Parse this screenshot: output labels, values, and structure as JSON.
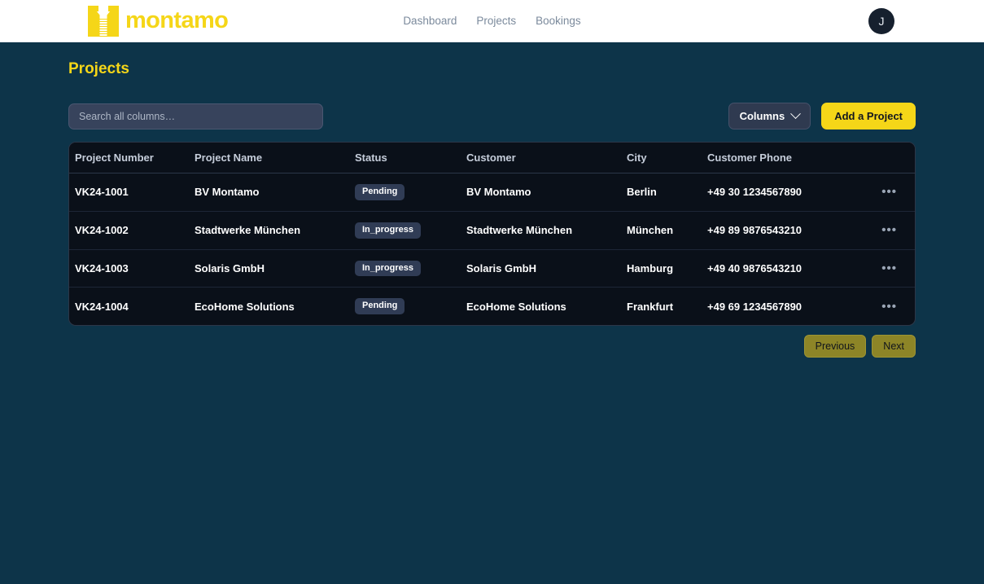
{
  "brand": {
    "name": "montamo",
    "logo_color": "#f5d618"
  },
  "nav": {
    "links": [
      {
        "label": "Dashboard"
      },
      {
        "label": "Projects"
      },
      {
        "label": "Bookings"
      }
    ]
  },
  "account": {
    "avatar_initial": "J"
  },
  "page": {
    "title": "Projects"
  },
  "search": {
    "placeholder": "Search all columns…",
    "value": ""
  },
  "toolbar": {
    "columns_label": "Columns",
    "add_project_label": "Add a Project"
  },
  "table": {
    "headers": [
      "Project Number",
      "Project Name",
      "Status",
      "Customer",
      "City",
      "Customer Phone"
    ],
    "rows": [
      {
        "project_number": "VK24-1001",
        "project_name": "BV Montamo",
        "status": "Pending",
        "customer": "BV Montamo",
        "city": "Berlin",
        "phone": "+49 30 1234567890",
        "actions": "•••"
      },
      {
        "project_number": "VK24-1002",
        "project_name": "Stadtwerke München",
        "status": "In_progress",
        "customer": "Stadtwerke München",
        "city": "München",
        "phone": "+49 89 9876543210",
        "actions": "•••"
      },
      {
        "project_number": "VK24-1003",
        "project_name": "Solaris GmbH",
        "status": "In_progress",
        "customer": "Solaris GmbH",
        "city": "Hamburg",
        "phone": "+49 40 9876543210",
        "actions": "•••"
      },
      {
        "project_number": "VK24-1004",
        "project_name": "EcoHome Solutions",
        "status": "Pending",
        "customer": "EcoHome Solutions",
        "city": "Frankfurt",
        "phone": "+49 69 1234567890",
        "actions": "•••"
      }
    ]
  },
  "pagination": {
    "previous_label": "Previous",
    "next_label": "Next"
  },
  "colors": {
    "accent": "#f5d618",
    "page_background": "#0d3449",
    "table_background": "#0a1019",
    "badge_background": "#303c55"
  }
}
